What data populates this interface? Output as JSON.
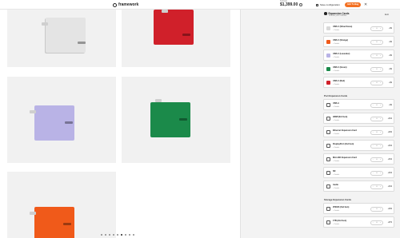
{
  "header": {
    "brand": "framework",
    "price_caption": "Subtotal",
    "price": "$1,399.00",
    "save_label": "Save configuration",
    "add_label": "Add To Bag",
    "close": "✕"
  },
  "panel": {
    "title": "Expansion Cards",
    "subtitle": "Choose your modules",
    "exit": "Exit",
    "sections": [
      {
        "title": "",
        "items": [
          {
            "name": "USB-C (Silver/Gone)",
            "details": "+ Details",
            "price": "+$9",
            "color": "#d9d9d9"
          },
          {
            "name": "USB-C (Orange)",
            "details": "+ Details",
            "price": "+$9",
            "color": "#f05a1a"
          },
          {
            "name": "USB-C (Lavender)",
            "details": "+ Details",
            "price": "+$9",
            "color": "#b9b3e6"
          },
          {
            "name": "USB-C (Green)",
            "details": "+ Details",
            "price": "+$9",
            "color": "#1b8a4a"
          },
          {
            "name": "USB-C (Red)",
            "details": "+ Details",
            "price": "+$9",
            "color": "#d0202a"
          }
        ]
      },
      {
        "title": "Port Expansion Cards",
        "items": [
          {
            "name": "USB-A",
            "details": "+ Details",
            "price": "+$9"
          },
          {
            "name": "HDMI (3rd Gen)",
            "details": "+ Details",
            "price": "+$19"
          },
          {
            "name": "Ethernet Expansion Card",
            "details": "+ Details",
            "price": "+$39"
          },
          {
            "name": "DisplayPort (2nd Gen)",
            "details": "+ Details",
            "price": "+$19"
          },
          {
            "name": "MicroSD Expansion Card",
            "details": "+ Details",
            "price": "+$19"
          },
          {
            "name": "SD",
            "details": "+ Details",
            "price": "+$19"
          },
          {
            "name": "Audio",
            "details": "+ Details",
            "price": "+$19"
          }
        ]
      },
      {
        "title": "Storage Expansion Cards",
        "items": [
          {
            "name": "250GB (2nd Gen)",
            "details": "+ Details",
            "price": "+$39"
          },
          {
            "name": "1TB (2nd Gen)",
            "details": "+ Details",
            "price": "+$79"
          }
        ]
      }
    ]
  },
  "stepper": {
    "minus": "–",
    "qty": "0",
    "plus": "+"
  },
  "gallery": {
    "tiles": [
      {
        "color": "#e4e4e4",
        "name": "silver"
      },
      {
        "color": "#d0202a",
        "name": "red"
      },
      {
        "color": "#b9b3e6",
        "name": "lavender"
      },
      {
        "color": "#1b8a4a",
        "name": "green"
      },
      {
        "color": "#f05a1a",
        "name": "orange"
      }
    ],
    "pager_count": 9,
    "pager_active": 5
  }
}
